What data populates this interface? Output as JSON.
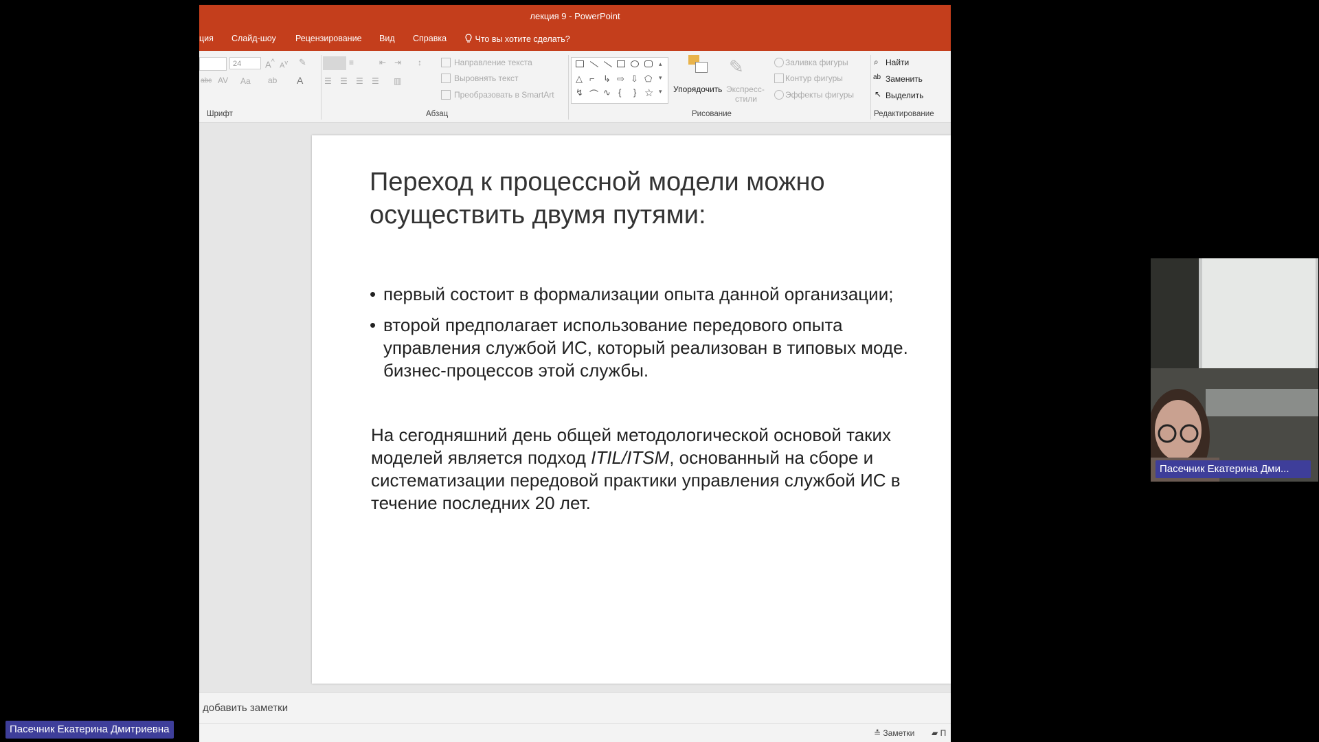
{
  "window": {
    "doc_name": "лекция 9",
    "app_name": "PowerPoint",
    "title_sep": "-"
  },
  "tabs": [
    "ция",
    "Слайд-шоу",
    "Рецензирование",
    "Вид",
    "Справка"
  ],
  "tell_me": "Что вы хотите сделать?",
  "ribbon": {
    "font_size": "24",
    "groups": {
      "font": "Шрифт",
      "paragraph": "Абзац",
      "drawing": "Рисование",
      "editing": "Редактирование"
    },
    "paragraph": {
      "text_direction": "Направление текста",
      "align_text": "Выровнять текст",
      "smartart": "Преобразовать в SmartArt"
    },
    "drawing": {
      "arrange": "Упорядочить",
      "quick_styles_1": "Экспресс-",
      "quick_styles_2": "стили",
      "shape_fill": "Заливка фигуры",
      "shape_outline": "Контур фигуры",
      "shape_effects": "Эффекты фигуры"
    },
    "editing": {
      "find": "Найти",
      "replace": "Заменить",
      "select": "Выделить"
    }
  },
  "slide": {
    "title_line1": "Переход к процессной модели можно",
    "title_line2": "осуществить двумя путями:",
    "bullet1": "первый состоит в формализации опыта данной организации;",
    "bullet2_line1": "второй предполагает использование передового опыта",
    "bullet2_line2": "управления службой ИС, который реализован в типовых моде.",
    "bullet2_line3": "бизнес-процессов этой службы.",
    "para_line1": "На сегодняшний день общей методологической основой таких",
    "para_line2_a": "моделей является подход ",
    "para_line2_b": "ITIL/ITSM",
    "para_line2_c": ", основанный на сборе и",
    "para_line3": "систематизации передовой практики управления службой ИС в",
    "para_line4": "течение последних 20 лет."
  },
  "notes_placeholder": "добавить заметки",
  "status": {
    "notes": "Заметки",
    "comments": "П"
  },
  "participant_video_name": "Пасечник Екатерина Дми...",
  "presenter_name": "Пасечник Екатерина Дмитриевна",
  "colors": {
    "accent": "#c43e1c",
    "nameplate": "#3e3e9a"
  }
}
